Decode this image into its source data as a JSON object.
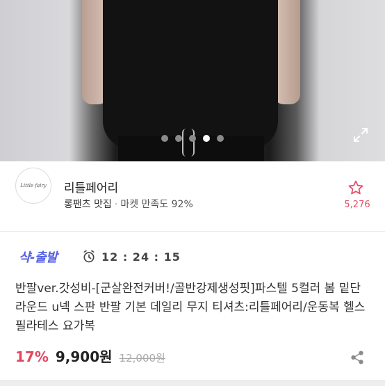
{
  "gallery": {
    "total_images": 5,
    "active_index": 3,
    "expand_icon": "expand-icon"
  },
  "seller": {
    "logo_text": "Little fairy",
    "name": "리틀페어리",
    "category": "롱팬츠 맛집",
    "separator": "·",
    "satisfaction_label": "마켓 만족도",
    "satisfaction_value": "92%",
    "favorite_icon": "star-icon",
    "favorite_count": "5,276",
    "favorite_color": "#e35068"
  },
  "deal": {
    "label": "샥-출발",
    "timer_icon": "alarm-clock-icon",
    "countdown": "12 : 24 : 15",
    "accent_color": "#5560e6"
  },
  "product": {
    "title": "반팔ver.갓성비-[군살완전커버!/골반강제생성핏]파스텔 5컬러 봄 밑단 라운드 u넥 스판 반팔 기본 데일리 무지 티셔츠:리틀페어리/운동복 헬스 필라테스 요가복",
    "discount": "17%",
    "price": "9,900원",
    "original_price": "12,000원",
    "discount_color": "#e4455f",
    "share_icon": "share-icon"
  }
}
